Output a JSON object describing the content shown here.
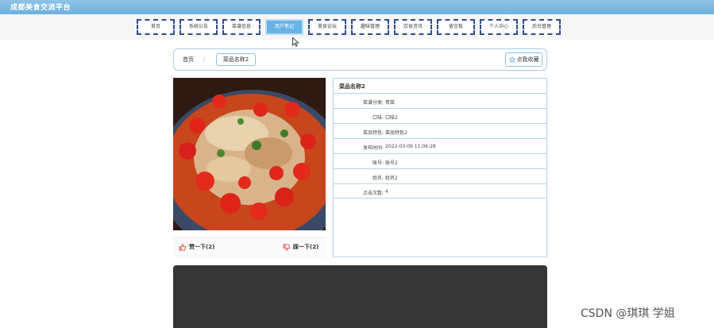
{
  "site": {
    "title": "成都美食交流平台"
  },
  "nav": {
    "items": [
      {
        "label": "首页"
      },
      {
        "label": "系统公告"
      },
      {
        "label": "菜谱信息"
      },
      {
        "label": "用户笔记",
        "active": true
      },
      {
        "label": "美食论坛"
      },
      {
        "label": "趣味管理"
      },
      {
        "label": "饮食资讯"
      },
      {
        "label": "留言板"
      },
      {
        "label": "个人中心"
      },
      {
        "label": "后台管理"
      }
    ]
  },
  "breadcrumb": {
    "home": "首页",
    "separator": "/",
    "current": "菜品名称2"
  },
  "favorite": {
    "label": "点我收藏"
  },
  "votes": {
    "like_label": "赞一下(2)",
    "dislike_label": "踩一下(2)"
  },
  "detail": {
    "title": "菜品名称2",
    "rows": [
      {
        "label": "菜谱分类:",
        "value": "粤菜"
      },
      {
        "label": "口味:",
        "value": "口味2"
      },
      {
        "label": "菜品特色:",
        "value": "菜品特色2"
      },
      {
        "label": "发布时间:",
        "value": "2022-03-09 11:06:28"
      },
      {
        "label": "账号:",
        "value": "账号2"
      },
      {
        "label": "姓名:",
        "value": "姓名2"
      },
      {
        "label": "点击次数:",
        "value": "4"
      }
    ]
  },
  "watermark": {
    "text": "CSDN @琪琪 学姐"
  },
  "colors": {
    "header_blue": "#6fb0dc",
    "nav_border": "#2f4c8f",
    "active_tab": "#6ab2e5",
    "panel_border": "#b3d4ec"
  }
}
